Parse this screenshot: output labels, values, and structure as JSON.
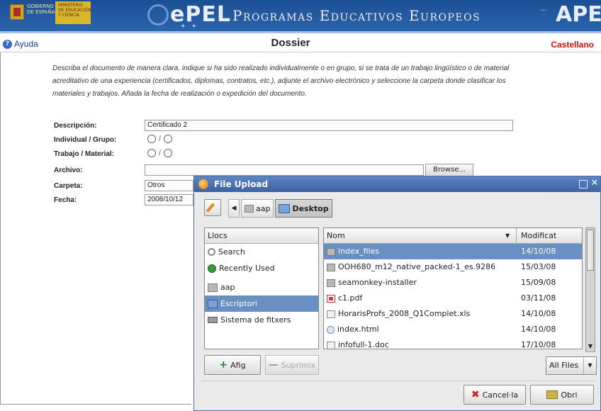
{
  "banner": {
    "gov_text": "GOBIERNO\nDE ESPAÑA",
    "ministry_text": "MINISTERIO\nDE EDUCACIÓN\nY CIENCIA",
    "epel_brand": "ePEL",
    "program_title": "Programas Educativos Europeos",
    "apee_brand": "APEE",
    "colors": {
      "banner_blue": "#2b64ad",
      "accent_red": "#d01010"
    }
  },
  "header": {
    "help_label": "Ayuda",
    "title": "Dossier",
    "language": "Castellano"
  },
  "intro": "Describa el documento de manera clara, indique si ha sido realizado individualmente o en grupo, si se trata de un trabajo lingüístico o de material acreditativo de una experiencia (certificados, diplomas, contratos, etc.), adjunte el archivo electrónico y seleccione la carpeta donde clasificar los materiales y trabajos. Añada la fecha de realización o expedición del documento.",
  "form": {
    "descripcion_label": "Descripción:",
    "descripcion_value": "Certificado 2",
    "individual_label": "Individual / Grupo:",
    "trabajo_label": "Trabajo / Material:",
    "radio_separator": "/",
    "archivo_label": "Archivo:",
    "archivo_value": "",
    "browse_label": "Browse...",
    "carpeta_label": "Carpeta:",
    "carpeta_value": "Otros",
    "fecha_label": "Fecha:",
    "fecha_value": "2008/10/12"
  },
  "dialog": {
    "title": "File Upload",
    "path": [
      "aap",
      "Desktop"
    ],
    "places_header": "Llocs",
    "places": [
      {
        "label": "Search",
        "icon": "search-icon"
      },
      {
        "label": "Recently Used",
        "icon": "recent-icon"
      },
      {
        "label": "aap",
        "icon": "folder-icon"
      },
      {
        "label": "Escriptori",
        "icon": "desktop-icon"
      },
      {
        "label": "Sistema de fitxers",
        "icon": "drive-icon"
      }
    ],
    "columns": {
      "name": "Nom",
      "modified": "Modificat"
    },
    "files": [
      {
        "name": "index_files",
        "date": "14/10/08",
        "icon": "folder"
      },
      {
        "name": "OOH680_m12_native_packed-1_es.9286",
        "date": "15/03/08",
        "icon": "folder"
      },
      {
        "name": "seamonkey-installer",
        "date": "15/09/08",
        "icon": "folder"
      },
      {
        "name": "c1.pdf",
        "date": "03/11/08",
        "icon": "pdf"
      },
      {
        "name": "HorarisProfs_2008_Q1Complet.xls",
        "date": "14/10/08",
        "icon": "xls"
      },
      {
        "name": "index.html",
        "date": "14/10/08",
        "icon": "html"
      },
      {
        "name": "infofull-1.doc",
        "date": "17/10/08",
        "icon": "doc"
      }
    ],
    "add_label": "Afig",
    "remove_label": "Suprimix",
    "filter_label": "All Files",
    "cancel_label": "Cancel·la",
    "open_label": "Obri"
  }
}
